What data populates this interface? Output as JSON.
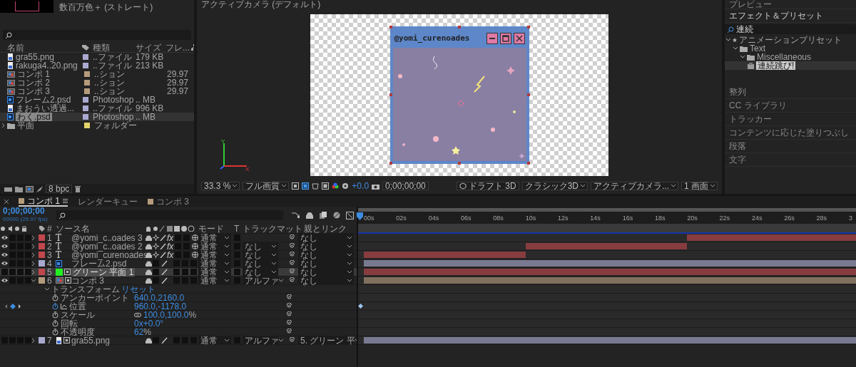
{
  "project": {
    "thumbnail": true,
    "info": "数百万色＋ (ストレート)",
    "columns": [
      "名前",
      "種類",
      "サイズ",
      "フレ..."
    ],
    "items": [
      {
        "name": "gra55.png",
        "type": "..ファイル",
        "size": "179 KB",
        "kind": "image",
        "color": "#a9a9d0",
        "selected": false
      },
      {
        "name": "rakuga4..20.png",
        "type": "..ファイル",
        "size": "213 KB",
        "kind": "image",
        "color": "#a9a9d0",
        "selected": false
      },
      {
        "name": "コンポ 1",
        "type": "..ション",
        "fps": "29.97",
        "kind": "comp",
        "color": "#b59b7c",
        "selected": false
      },
      {
        "name": "コンポ 2",
        "type": "..ション",
        "fps": "29.97",
        "kind": "comp",
        "color": "#b59b7c",
        "selected": false
      },
      {
        "name": "コンポ 3",
        "type": "..ション",
        "fps": "29.97",
        "kind": "comp",
        "color": "#b59b7c",
        "selected": false
      },
      {
        "name": "フレーム2.psd",
        "type": "Photoshop",
        "size": ".. MB",
        "kind": "psd",
        "color": "#a9a9d0",
        "selected": false
      },
      {
        "name": "まおうい透過...",
        "type": "..ファイル",
        "size": "996 KB",
        "kind": "image",
        "color": "#a9a9d0",
        "selected": false
      },
      {
        "name": "わく.psd",
        "type": "Photoshop",
        "size": ".. MB",
        "kind": "psd",
        "color": "#a9a9d0",
        "selected": true
      },
      {
        "name": "平面",
        "type": "フォルダー",
        "kind": "folder",
        "color": "#e3d46e",
        "selected": false
      }
    ],
    "bpc": "8 bpc"
  },
  "viewer": {
    "camera_label": "アクティブカメラ (デフォルト)",
    "frame_title": "@yomi_curenoades",
    "axis_x": "X",
    "axis_y": "Y",
    "toolbar": {
      "zoom": "33.3 %",
      "resolution": "フル画質",
      "exposure": "+0.0",
      "timecode": "0;00;00;00",
      "draft": "ドラフト 3D",
      "renderer": "クラシック3D",
      "camera": "アクティブカメラ...",
      "views": "1 画面"
    }
  },
  "right_panel": {
    "top_panel": "プレビュー",
    "effects_title": "エフェクト＆プリセット",
    "search_value": "連続",
    "tree": [
      {
        "label": "アニメーションプリセット",
        "kind": "presets",
        "expanded": true,
        "selected": false,
        "children": [
          {
            "label": "Text",
            "kind": "folder",
            "expanded": true,
            "selected": false,
            "children": [
              {
                "label": "Miscellaneous",
                "kind": "folder",
                "expanded": true,
                "selected": false,
                "children": [
                  {
                    "label": "連続跳び!",
                    "kind": "preset",
                    "selected": true
                  }
                ]
              }
            ]
          }
        ]
      }
    ],
    "panels": [
      "整列",
      "CC ライブラリ",
      "トラッカー",
      "コンテンツに応じた塗りつぶし",
      "段落",
      "文字"
    ]
  },
  "timeline": {
    "tabs": [
      {
        "label": "コンポ 1",
        "color": "#b59b7c",
        "selected": true
      },
      {
        "label": "レンダーキュー",
        "selected": false
      },
      {
        "label": "コンポ 3",
        "color": "#b59b7c",
        "selected": false
      }
    ],
    "timecode": "0;00;00;00",
    "frame_info": "00000 (29.97 fps)",
    "columns": {
      "number": "#",
      "source": "ソース名",
      "mode": "モード",
      "t": "T",
      "matte": "トラックマット",
      "parent": "親とリンク"
    },
    "ruler": [
      "00s",
      "02s",
      "04s",
      "06s",
      "08s",
      "10s",
      "12s",
      "14s",
      "16s",
      "18s",
      "20s",
      "22s",
      "24s",
      "26s",
      "28s",
      "3"
    ],
    "layers": [
      {
        "number": "1",
        "name": "@yomi_c..oades 3",
        "kind": "text",
        "icon_text": "T",
        "color": "#c0474c",
        "visible": true,
        "selected": false,
        "expanded": false,
        "fx": "fx",
        "layer_3d": true,
        "mode": "通常",
        "parent": "なし"
      },
      {
        "number": "2",
        "name": "@yomi_c..oades 2",
        "kind": "text",
        "icon_text": "T",
        "color": "#c0474c",
        "visible": true,
        "selected": false,
        "expanded": false,
        "fx": "fx",
        "layer_3d": true,
        "mode": "通常",
        "matte": "なし",
        "parent": "なし"
      },
      {
        "number": "3",
        "name": "@yomi_curenoades",
        "kind": "text",
        "icon_text": "T",
        "color": "#c0474c",
        "visible": true,
        "selected": false,
        "expanded": false,
        "fx": "fx",
        "layer_3d": true,
        "mode": "通常",
        "matte": "なし",
        "parent": "なし"
      },
      {
        "number": "4",
        "name": "フレーム2.psd",
        "kind": "psd",
        "color": "#a9a9d0",
        "visible": true,
        "selected": false,
        "expanded": false,
        "layer_3d": false,
        "mode": "通常",
        "matte": "なし",
        "parent": "なし"
      },
      {
        "number": "5",
        "name": "グリーン 平面 1",
        "kind": "solid",
        "color": "#c0474c",
        "visible": false,
        "selected": true,
        "expanded": false,
        "layer_3d": false,
        "mode": "通常",
        "matte": "なし",
        "parent": "なし"
      },
      {
        "number": "6",
        "name": "コンポ 3",
        "kind": "comp",
        "color": "#b59b7c",
        "visible": true,
        "selected": false,
        "expanded": true,
        "layer_3d": false,
        "mode": "通常",
        "matte": "アルファ",
        "parent": "なし",
        "transform": {
          "label": "トランスフォーム",
          "reset": "リセット",
          "properties": [
            {
              "name": "アンカーポイント",
              "value": "640.0,2160.0",
              "animated": false,
              "linked": false
            },
            {
              "name": "位置",
              "value": "960.0,-1178.0",
              "animated": true,
              "linked": false
            },
            {
              "name": "スケール",
              "value": "100.0,100.0",
              "unit": "%",
              "animated": false,
              "linked": true
            },
            {
              "name": "回転",
              "value": "0x+0.0°",
              "animated": false,
              "linked": false
            },
            {
              "name": "不透明度",
              "value": "62",
              "unit": "%",
              "animated": false,
              "linked": false
            }
          ]
        }
      },
      {
        "number": "7",
        "name": "gra55.png",
        "kind": "image",
        "color": "#a9a9d0",
        "visible": false,
        "selected": false,
        "expanded": false,
        "layer_3d": false,
        "mode": "通常",
        "matte": "アルファ",
        "parent": "5. グリーン 平"
      }
    ]
  }
}
